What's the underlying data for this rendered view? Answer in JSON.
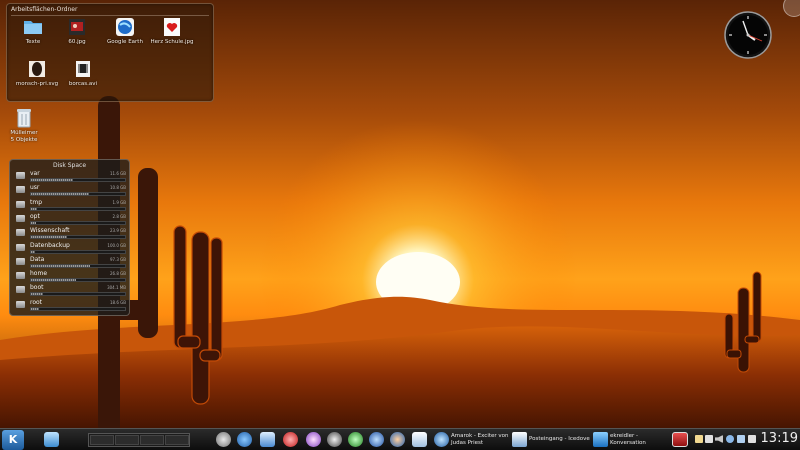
{
  "folderview": {
    "title": "Arbeitsflächen-Ordner",
    "icons": [
      {
        "label": "Texte",
        "icon": "folder-icon"
      },
      {
        "label": "60.jpg",
        "icon": "image-file-icon"
      },
      {
        "label": "Google Earth",
        "icon": "google-earth-icon"
      },
      {
        "label": "Herz Schule.jpg",
        "icon": "image-file-icon"
      },
      {
        "label": "monsch-pri.svg",
        "icon": "image-file-icon"
      },
      {
        "label": "borcas.avi",
        "icon": "video-file-icon"
      }
    ]
  },
  "trash": {
    "label": "Mülleimer",
    "sublabel": "5 Objekte"
  },
  "diskspace": {
    "title": "Disk Space",
    "disks": [
      {
        "name": "var",
        "percent": 0.45,
        "size": "11.6 GB"
      },
      {
        "name": "usr",
        "percent": 0.62,
        "size": "10.8 GB"
      },
      {
        "name": "tmp",
        "percent": 0.06,
        "size": "1.9 GB"
      },
      {
        "name": "opt",
        "percent": 0.05,
        "size": "2.8 GB"
      },
      {
        "name": "Wissenschaft",
        "percent": 0.38,
        "size": "23.9 GB"
      },
      {
        "name": "Datenbackup",
        "percent": 0.04,
        "size": "100.0 GB"
      },
      {
        "name": "Data",
        "percent": 0.63,
        "size": "97.3 GB"
      },
      {
        "name": "home",
        "percent": 0.48,
        "size": "26.8 GB"
      },
      {
        "name": "boot",
        "percent": 0.13,
        "size": "304.1 MB"
      },
      {
        "name": "root",
        "percent": 0.09,
        "size": "18.6 GB"
      }
    ]
  },
  "taskbar": {
    "tasks": [
      {
        "label": "Amarok - Exciter von Judas Priest",
        "icon": "amarok-icon"
      },
      {
        "label": "Posteingang - Icedove",
        "icon": "mail-icon"
      },
      {
        "label": "ekreidler - Konversation",
        "icon": "chat-icon"
      }
    ],
    "time": "13:19"
  },
  "colors": {
    "accent": "#ff8c00",
    "sun": "#fff8e0",
    "cactus": "#3a1608"
  }
}
